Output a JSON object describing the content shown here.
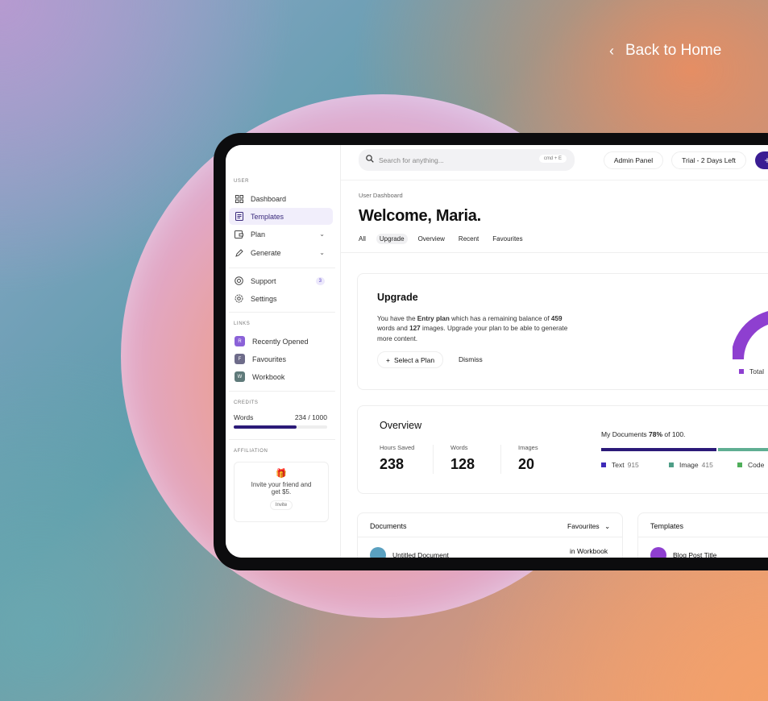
{
  "back_link": {
    "label": "Back to Home"
  },
  "sidebar": {
    "user_section": "USER",
    "items": [
      {
        "label": "Dashboard",
        "icon": "grid-icon"
      },
      {
        "label": "Templates",
        "icon": "document-icon"
      },
      {
        "label": "Plan",
        "icon": "wallet-icon"
      },
      {
        "label": "Generate",
        "icon": "pen-icon"
      },
      {
        "label": "Support",
        "icon": "lifebuoy-icon",
        "badge": "3"
      },
      {
        "label": "Settings",
        "icon": "gear-icon"
      }
    ],
    "links_section": "LINKS",
    "links": [
      {
        "letter": "R",
        "label": "Recently Opened",
        "color": "#8b62d8"
      },
      {
        "letter": "F",
        "label": "Favourites",
        "color": "#6e6c8a"
      },
      {
        "letter": "W",
        "label": "Workbook",
        "color": "#5f7a7a"
      }
    ],
    "credits_section": "CREDITS",
    "credits": {
      "label": "Words",
      "value": "234 / 1000",
      "fraction": 0.67
    },
    "affiliation_section": "AFFILIATION",
    "affiliation": {
      "text": "Invite your friend and get $5.",
      "button": "Invite"
    }
  },
  "topbar": {
    "search_placeholder": "Search for anything...",
    "shortcut": "cmd + E",
    "admin_label": "Admin Panel",
    "trial_label": "Trial - 2 Days Left",
    "plus_label": "+"
  },
  "header": {
    "breadcrumb": "User Dashboard",
    "welcome": "Welcome, Maria.",
    "tabs": [
      "All",
      "Upgrade",
      "Overview",
      "Recent",
      "Favourites"
    ]
  },
  "upgrade": {
    "title": "Upgrade",
    "text_1": "You have the ",
    "plan": "Entry plan",
    "text_2": " which has a remaining balance of ",
    "words": "459",
    "text_3": " words and ",
    "images": "127",
    "text_4": " images. Upgrade your plan to be able to generate more content.",
    "select_button": "Select a Plan",
    "dismiss_button": "Dismiss",
    "legend_total": "Total",
    "accent": "#8e3fd0"
  },
  "overview": {
    "title": "Overview",
    "stats": [
      {
        "label": "Hours Saved",
        "value": "238"
      },
      {
        "label": "Words",
        "value": "128"
      },
      {
        "label": "Images",
        "value": "20"
      }
    ],
    "documents_prefix": "My Documents ",
    "documents_percent": "78%",
    "documents_suffix": " of 100.",
    "legend": [
      {
        "label": "Text",
        "value": "915",
        "color": "#3d2ab8"
      },
      {
        "label": "Image",
        "value": "415",
        "color": "#4f9e87"
      },
      {
        "label": "Code",
        "value": "",
        "color": "#4fae5a"
      }
    ]
  },
  "documents_card": {
    "title": "Documents",
    "filter": "Favourites",
    "row_title": "Untitled Document",
    "row_location": "in Workbook"
  },
  "templates_card": {
    "title": "Templates",
    "row_title": "Blog Post Title"
  }
}
